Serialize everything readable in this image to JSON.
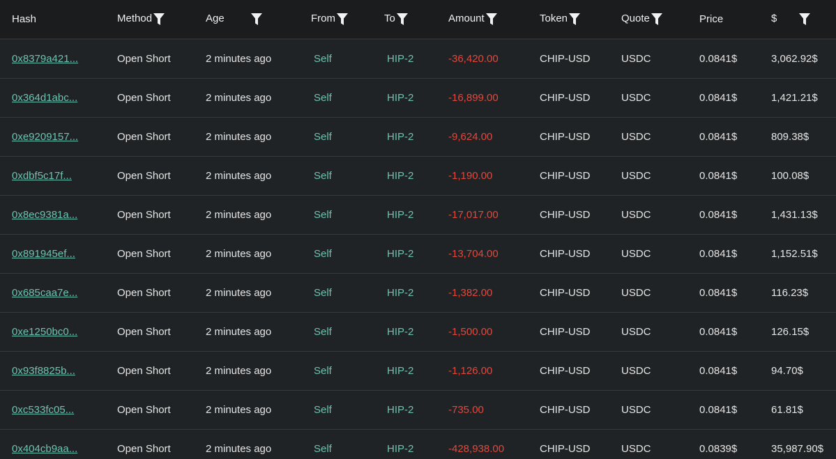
{
  "columns": [
    "Hash",
    "Method",
    "Age",
    "From",
    "To",
    "Amount",
    "Token",
    "Quote",
    "Price",
    "$"
  ],
  "colors": {
    "link": "#6cc3b1",
    "negative": "#e2483d",
    "header_bg": "#1b1c1d",
    "row_bg": "#202325"
  },
  "rows": [
    {
      "hash": "0x8379a421...",
      "method": "Open Short",
      "age": "2 minutes ago",
      "from": "Self",
      "to": "HIP-2",
      "amount": "-36,420.00",
      "token": "CHIP-USD",
      "quote": "USDC",
      "price": "0.0841$",
      "usd": "3,062.92$"
    },
    {
      "hash": "0x364d1abc...",
      "method": "Open Short",
      "age": "2 minutes ago",
      "from": "Self",
      "to": "HIP-2",
      "amount": "-16,899.00",
      "token": "CHIP-USD",
      "quote": "USDC",
      "price": "0.0841$",
      "usd": "1,421.21$"
    },
    {
      "hash": "0xe9209157...",
      "method": "Open Short",
      "age": "2 minutes ago",
      "from": "Self",
      "to": "HIP-2",
      "amount": "-9,624.00",
      "token": "CHIP-USD",
      "quote": "USDC",
      "price": "0.0841$",
      "usd": "809.38$"
    },
    {
      "hash": "0xdbf5c17f...",
      "method": "Open Short",
      "age": "2 minutes ago",
      "from": "Self",
      "to": "HIP-2",
      "amount": "-1,190.00",
      "token": "CHIP-USD",
      "quote": "USDC",
      "price": "0.0841$",
      "usd": "100.08$"
    },
    {
      "hash": "0x8ec9381a...",
      "method": "Open Short",
      "age": "2 minutes ago",
      "from": "Self",
      "to": "HIP-2",
      "amount": "-17,017.00",
      "token": "CHIP-USD",
      "quote": "USDC",
      "price": "0.0841$",
      "usd": "1,431.13$"
    },
    {
      "hash": "0x891945ef...",
      "method": "Open Short",
      "age": "2 minutes ago",
      "from": "Self",
      "to": "HIP-2",
      "amount": "-13,704.00",
      "token": "CHIP-USD",
      "quote": "USDC",
      "price": "0.0841$",
      "usd": "1,152.51$"
    },
    {
      "hash": "0x685caa7e...",
      "method": "Open Short",
      "age": "2 minutes ago",
      "from": "Self",
      "to": "HIP-2",
      "amount": "-1,382.00",
      "token": "CHIP-USD",
      "quote": "USDC",
      "price": "0.0841$",
      "usd": "116.23$"
    },
    {
      "hash": "0xe1250bc0...",
      "method": "Open Short",
      "age": "2 minutes ago",
      "from": "Self",
      "to": "HIP-2",
      "amount": "-1,500.00",
      "token": "CHIP-USD",
      "quote": "USDC",
      "price": "0.0841$",
      "usd": "126.15$"
    },
    {
      "hash": "0x93f8825b...",
      "method": "Open Short",
      "age": "2 minutes ago",
      "from": "Self",
      "to": "HIP-2",
      "amount": "-1,126.00",
      "token": "CHIP-USD",
      "quote": "USDC",
      "price": "0.0841$",
      "usd": "94.70$"
    },
    {
      "hash": "0xc533fc05...",
      "method": "Open Short",
      "age": "2 minutes ago",
      "from": "Self",
      "to": "HIP-2",
      "amount": "-735.00",
      "token": "CHIP-USD",
      "quote": "USDC",
      "price": "0.0841$",
      "usd": "61.81$"
    },
    {
      "hash": "0x404cb9aa...",
      "method": "Open Short",
      "age": "2 minutes ago",
      "from": "Self",
      "to": "HIP-2",
      "amount": "-428,938.00",
      "token": "CHIP-USD",
      "quote": "USDC",
      "price": "0.0839$",
      "usd": "35,987.90$"
    }
  ]
}
